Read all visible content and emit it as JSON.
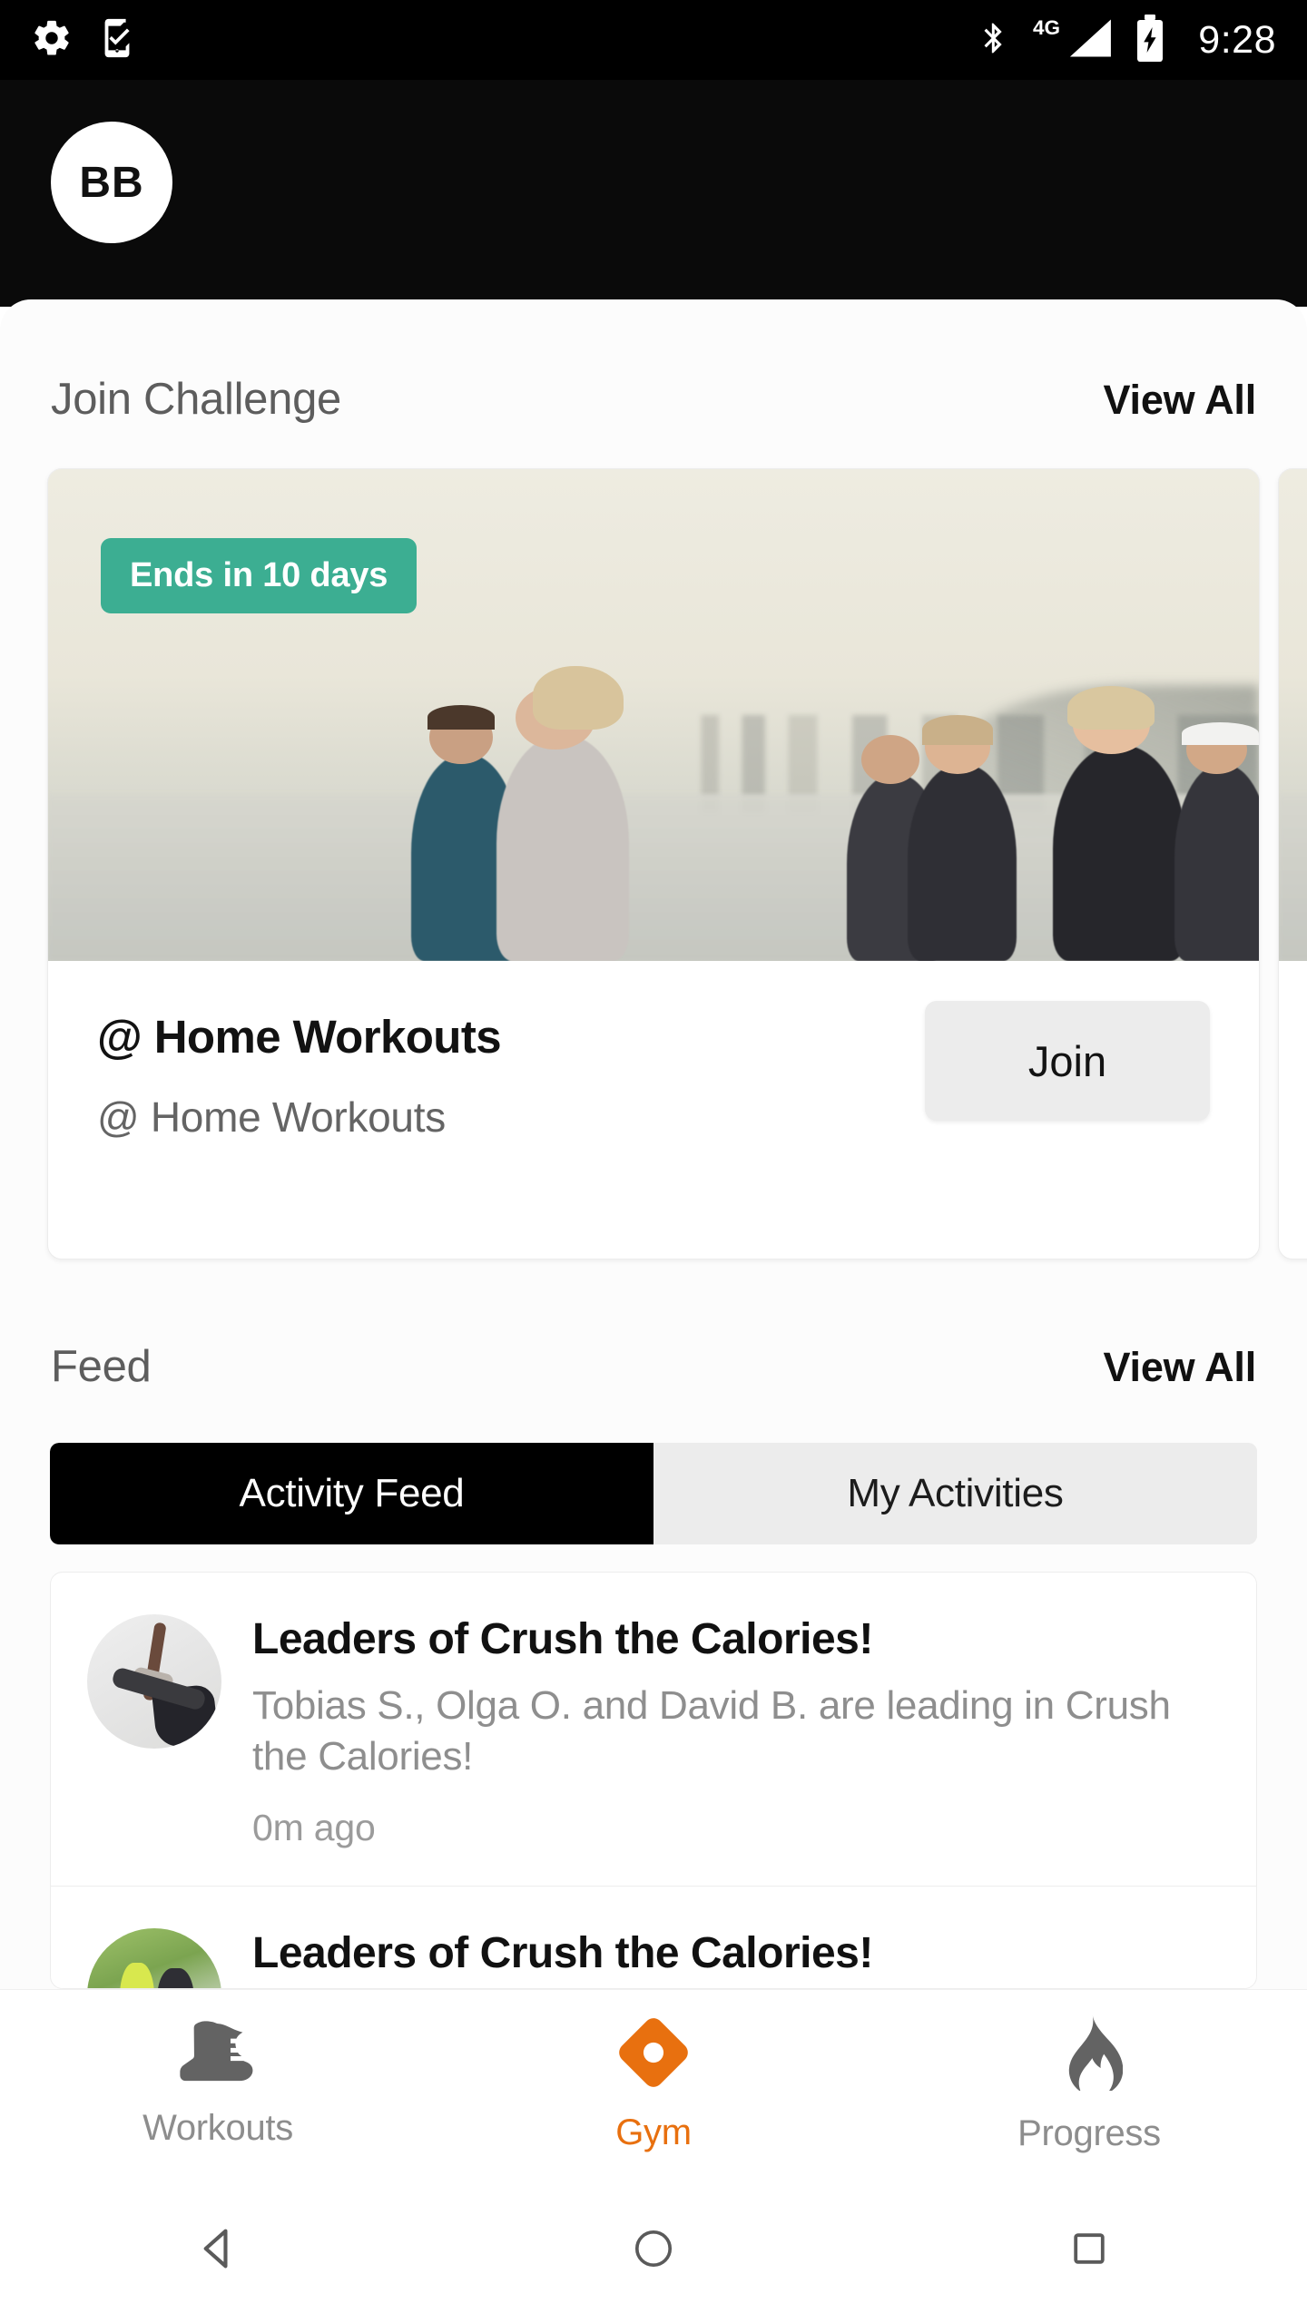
{
  "status_bar": {
    "left_icons": [
      "settings-gear-icon",
      "phone-check-icon"
    ],
    "right_icons": [
      "bluetooth-icon",
      "signal-4g-icon",
      "battery-charging-icon"
    ],
    "network_label": "4G",
    "clock": "9:28"
  },
  "header": {
    "avatar_initials": "BB"
  },
  "challenge_section": {
    "title": "Join Challenge",
    "view_all": "View All",
    "cards": [
      {
        "badge": "Ends in 10 days",
        "title": "@ Home Workouts",
        "subtitle": "@ Home Workouts",
        "action": "Join"
      }
    ]
  },
  "feed_section": {
    "title": "Feed",
    "view_all": "View All",
    "tabs": [
      {
        "label": "Activity Feed",
        "active": true
      },
      {
        "label": "My Activities",
        "active": false
      }
    ],
    "items": [
      {
        "avatar": "yoga-pose-avatar",
        "title": "Leaders of Crush the Calories!",
        "description": "Tobias S., Olga O. and David B. are leading in Crush the Calories!",
        "time": "0m ago"
      },
      {
        "avatar": "outdoor-runner-avatar",
        "title": "Leaders of Crush the Calories!",
        "description": "",
        "time": ""
      }
    ]
  },
  "bottom_nav": {
    "items": [
      {
        "label": "Workouts",
        "icon": "sneaker-icon",
        "active": false
      },
      {
        "label": "Gym",
        "icon": "gym-diamond-icon",
        "active": true
      },
      {
        "label": "Progress",
        "icon": "flame-icon",
        "active": false
      }
    ]
  },
  "system_nav": {
    "back": "back-triangle-icon",
    "home": "home-circle-icon",
    "recents": "recents-square-icon"
  },
  "colors": {
    "badge_teal": "#3cae92",
    "accent_orange": "#e8700f",
    "tab_active_bg": "#000000",
    "tab_inactive_bg": "#ececec",
    "header_black": "#0a0a0a",
    "sheet_bg": "#fcfcfc"
  }
}
